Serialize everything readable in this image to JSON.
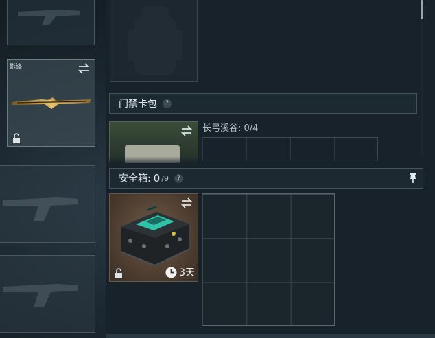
{
  "left_column": {
    "weapon_slot": {
      "name": "影锋",
      "swap_icon": "swap-arrows-icon",
      "lock_icon": "unlock-icon"
    }
  },
  "access_card": {
    "title": "门禁卡包",
    "help": "?",
    "map_label": "长弓溪谷: 0/4"
  },
  "safe_box": {
    "title": "安全箱:",
    "count": "0",
    "capacity": "/9",
    "help": "?",
    "timer": "3天",
    "pin_icon": "pin-icon"
  },
  "colors": {
    "panel_bg": "#18222a",
    "accent_teal": "#2fc3a8",
    "safebox_bg": "#4a3a2e"
  }
}
